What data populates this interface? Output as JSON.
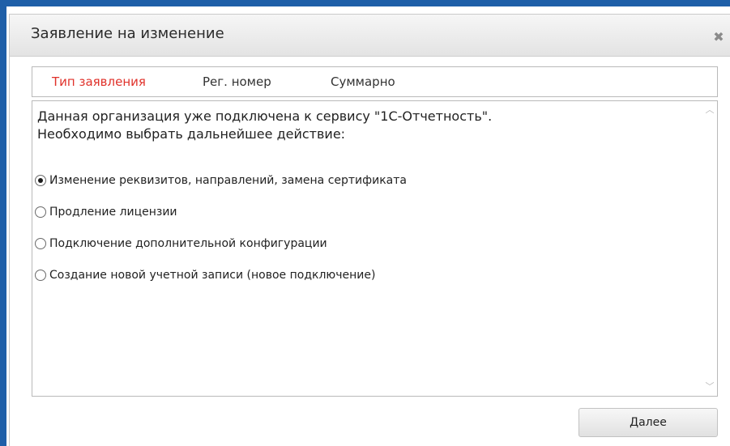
{
  "dialog": {
    "title": "Заявление на изменение",
    "close_glyph": "✖"
  },
  "tabs": [
    {
      "label": "Тип заявления",
      "active": true
    },
    {
      "label": "Рег. номер",
      "active": false
    },
    {
      "label": "Суммарно",
      "active": false
    }
  ],
  "content": {
    "description_line1": "Данная организация уже подключена к сервису \"1С-Отчетность\".",
    "description_line2": "Необходимо выбрать дальнейшее действие:",
    "options": [
      {
        "label": "Изменение реквизитов, направлений, замена сертификата",
        "selected": true
      },
      {
        "label": "Продление лицензии",
        "selected": false
      },
      {
        "label": "Подключение дополнительной конфигурации",
        "selected": false
      },
      {
        "label": "Создание новой учетной записи (новое подключение)",
        "selected": false
      }
    ],
    "scroll_up_glyph": "︿",
    "scroll_down_glyph": "﹀"
  },
  "footer": {
    "next_label": "Далее"
  },
  "colors": {
    "frame_blue": "#1f5fa8",
    "active_tab": "#e0322b"
  },
  "icons": {
    "close": "close-icon",
    "scroll_up": "chevron-up-icon",
    "scroll_down": "chevron-down-icon"
  }
}
